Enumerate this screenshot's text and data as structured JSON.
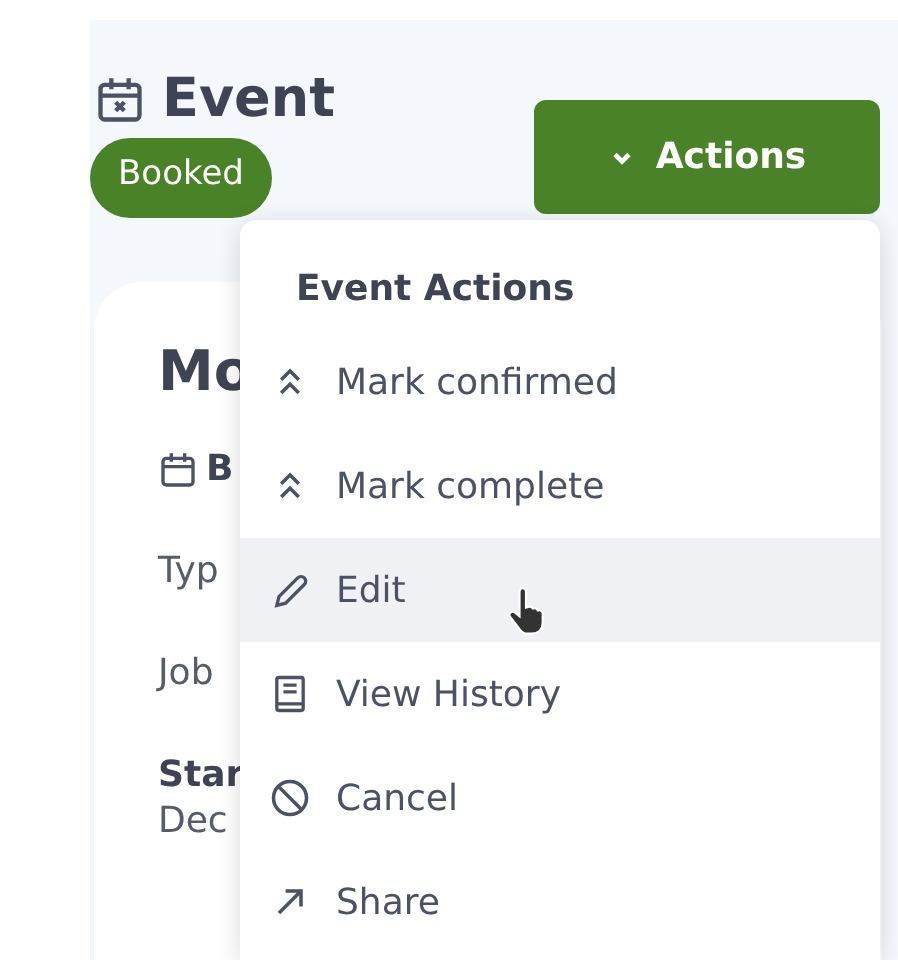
{
  "header": {
    "title": "Event",
    "status": "Booked"
  },
  "actions_button": {
    "label": "Actions"
  },
  "card": {
    "title": "Mo",
    "date": "B",
    "fields": [
      {
        "kind": "plain",
        "text": "Typ"
      },
      {
        "kind": "plain",
        "text": "Job"
      },
      {
        "kind": "bold",
        "text": "Star"
      },
      {
        "kind": "plain",
        "text": "Dec"
      }
    ]
  },
  "menu": {
    "title": "Event Actions",
    "items": [
      {
        "kind": "chevrons",
        "label": "Mark confirmed",
        "hovered": false
      },
      {
        "kind": "chevrons",
        "label": "Mark complete",
        "hovered": false
      },
      {
        "kind": "pencil",
        "label": "Edit",
        "hovered": true
      },
      {
        "kind": "history",
        "label": "View History",
        "hovered": false
      },
      {
        "kind": "cancel",
        "label": "Cancel",
        "hovered": false
      },
      {
        "kind": "share",
        "label": "Share",
        "hovered": false
      }
    ]
  }
}
